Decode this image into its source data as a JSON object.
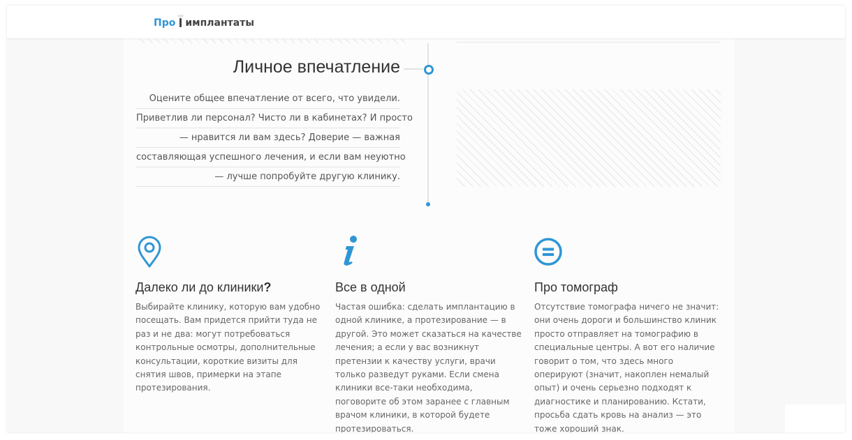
{
  "brand": {
    "logo_prefix": "Про",
    "logo_suffix": "имплантаты"
  },
  "impression": {
    "title": "Личное впечатление",
    "lines": [
      "Оцените общее впечатление от всего, что увидели.",
      "Приветлив ли персонал? Чисто ли в кабинетах? И просто",
      "— нравится ли вам здесь? Доверие — важная",
      "составляющая успешного лечения, и если вам неуютно",
      "— лучше попробуйте другую клинику."
    ]
  },
  "features": [
    {
      "icon": "location-pin-icon",
      "title": "Далеко ли до клиники",
      "title_mark": "?",
      "text": "Выбирайте клинику, которую вам удобно посещать. Вам придется прийти туда не раз и не два: могут потребоваться контрольные осмотры, дополнительные консультации, короткие визиты для снятия швов, примерки на этапе протезирования."
    },
    {
      "icon": "info-icon",
      "title": "Все в одной",
      "text": "Частая ошибка: сделать имплантацию в одной клинике, а протезирование — в другой. Это может сказаться на качестве лечения; а если у вас возникнут претензии к качеству услуги, врачи только разведут руками. Если смена клиники все-таки необходима, поговорите об этом заранее с главным врачом клиники, в которой будете протезироваться."
    },
    {
      "icon": "equals-circle-icon",
      "title": "Про томограф",
      "text": "Отсутствие томографа ничего не значит: они очень дороги и большинство клиник просто отправляет на томографию в специальные центры. А вот его наличие говорит о том, что здесь много оперируют (значит, накоплен немалый опыт) и очень серьезно подходят к диагностике и планированию. Кстати, просьба сдать кровь на анализ — это тоже хороший знак."
    }
  ],
  "colors": {
    "accent": "#2f96d6",
    "text": "#333333",
    "muted": "#666666"
  }
}
